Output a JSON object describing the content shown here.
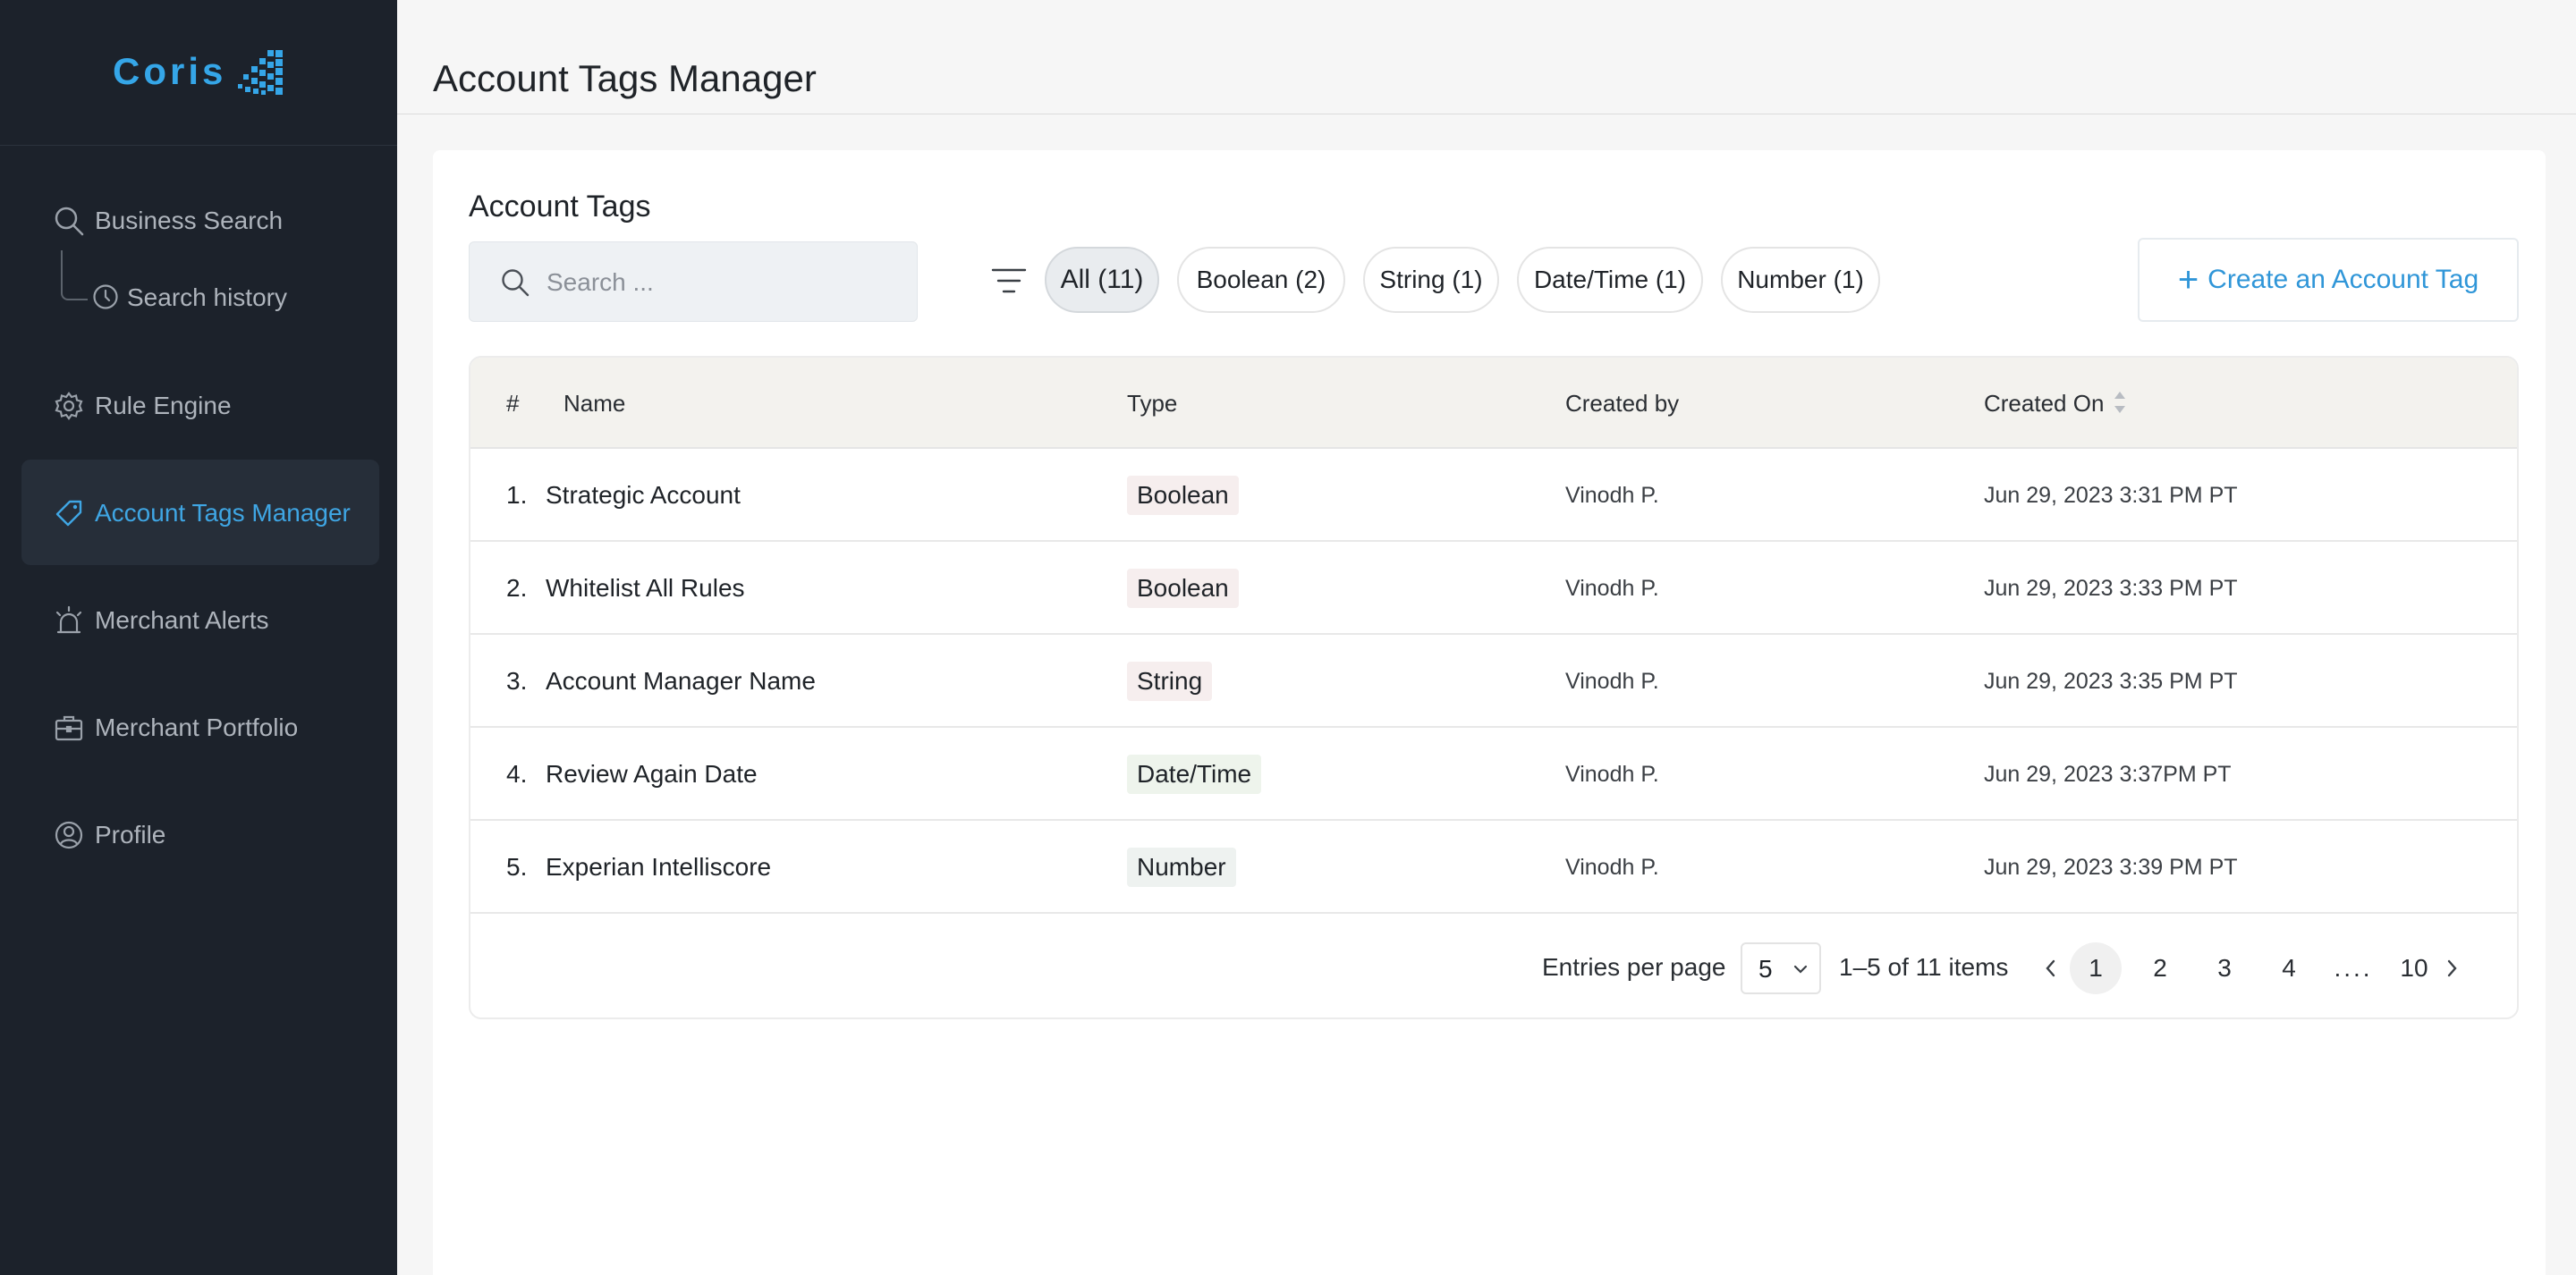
{
  "brand": {
    "name": "Coris",
    "accent": "#35a6e8"
  },
  "sidebar": {
    "items": [
      {
        "label": "Business Search",
        "icon": "search-icon"
      },
      {
        "label": "Search history",
        "icon": "clock-icon"
      },
      {
        "label": "Rule Engine",
        "icon": "gear-icon"
      },
      {
        "label": "Account Tags Manager",
        "icon": "tag-icon"
      },
      {
        "label": "Merchant Alerts",
        "icon": "siren-icon"
      },
      {
        "label": "Merchant Portfolio",
        "icon": "briefcase-icon"
      },
      {
        "label": "Profile",
        "icon": "user-circle-icon"
      }
    ]
  },
  "header": {
    "title": "Account Tags Manager"
  },
  "main": {
    "section_title": "Account Tags",
    "search": {
      "placeholder": "Search ...",
      "value": ""
    },
    "filters": [
      "All (11)",
      "Boolean (2)",
      "String (1)",
      "Date/Time (1)",
      "Number (1)"
    ],
    "create_button": "Create an Account Tag",
    "table": {
      "columns": [
        "#",
        "Name",
        "Type",
        "Created by",
        "Created On"
      ],
      "rows": [
        {
          "index": "1.",
          "name": "Strategic Account",
          "type": "Boolean",
          "created_by": "Vinodh P.",
          "created_on": "Jun 29, 2023 3:31 PM PT"
        },
        {
          "index": "2.",
          "name": "Whitelist All Rules",
          "type": "Boolean",
          "created_by": "Vinodh P.",
          "created_on": "Jun 29, 2023 3:33 PM PT"
        },
        {
          "index": "3.",
          "name": "Account Manager Name",
          "type": "String",
          "created_by": "Vinodh P.",
          "created_on": "Jun 29, 2023 3:35 PM PT"
        },
        {
          "index": "4.",
          "name": "Review Again Date",
          "type": "Date/Time",
          "created_by": "Vinodh P.",
          "created_on": "Jun 29, 2023 3:37PM PT"
        },
        {
          "index": "5.",
          "name": "Experian Intelliscore",
          "type": "Number",
          "created_by": "Vinodh P.",
          "created_on": "Jun 29, 2023 3:39 PM PT"
        }
      ],
      "type_colors": {
        "Boolean": "#f6eeee",
        "String": "#f6eeee",
        "Date/Time": "#eef4ec",
        "Number": "#eef2f0"
      }
    },
    "pagination": {
      "entries_label": "Entries per page",
      "per_page": "5",
      "range": "1–5 of 11 items",
      "pages": [
        "1",
        "2",
        "3",
        "4",
        "....",
        "10"
      ]
    }
  }
}
